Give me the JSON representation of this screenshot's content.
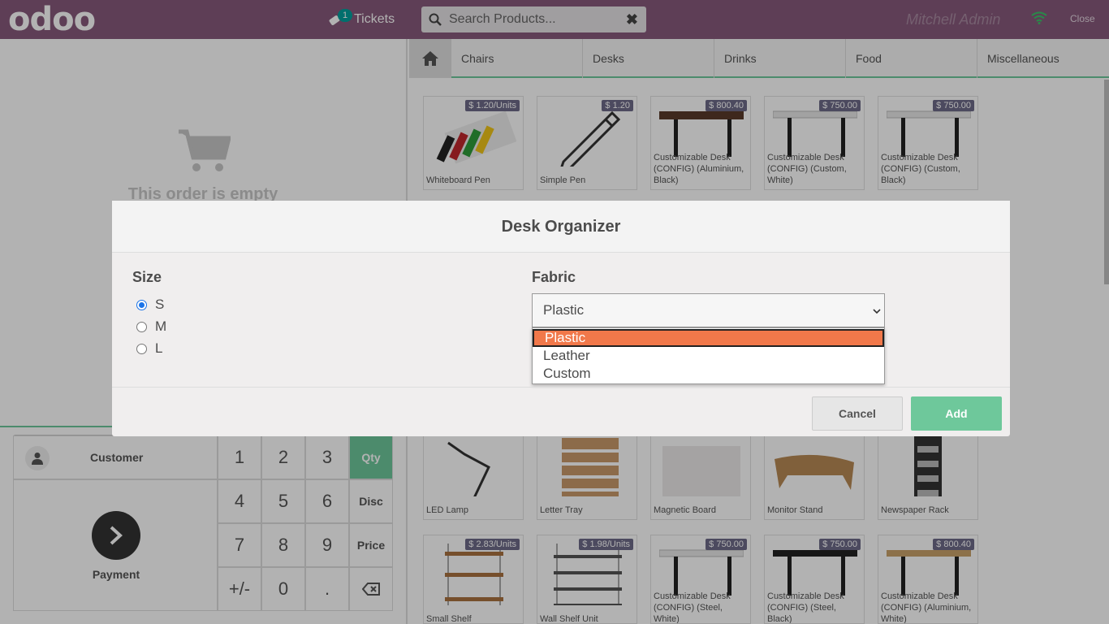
{
  "header": {
    "logo": "odoo",
    "tickets_label": "Tickets",
    "tickets_count": "1",
    "search_placeholder": "Search Products...",
    "user_name": "Mitchell Admin",
    "close_label": "Close"
  },
  "order": {
    "empty_text": "This order is empty"
  },
  "pad": {
    "customer_label": "Customer",
    "payment_label": "Payment",
    "keys": [
      "1",
      "2",
      "3",
      "Qty",
      "4",
      "5",
      "6",
      "Disc",
      "7",
      "8",
      "9",
      "Price",
      "+/-",
      "0",
      ".",
      "⌫"
    ]
  },
  "categories": [
    "Chairs",
    "Desks",
    "Drinks",
    "Food",
    "Miscellaneous"
  ],
  "products_row1": [
    {
      "name": "Whiteboard Pen",
      "price": "$ 1.20/Units"
    },
    {
      "name": "Simple Pen",
      "price": "$ 1.20"
    },
    {
      "name": "Customizable Desk (CONFIG) (Aluminium, Black)",
      "price": "$ 800.40"
    },
    {
      "name": "Customizable Desk (CONFIG) (Custom, White)",
      "price": "$ 750.00"
    },
    {
      "name": "Customizable Desk (CONFIG) (Custom, Black)",
      "price": "$ 750.00"
    }
  ],
  "products_row2": [
    {
      "name": "LED Lamp"
    },
    {
      "name": "Letter Tray"
    },
    {
      "name": "Magnetic Board"
    },
    {
      "name": "Monitor Stand"
    },
    {
      "name": "Newspaper Rack"
    }
  ],
  "products_row3": [
    {
      "name": "Small Shelf",
      "price": "$ 2.83/Units"
    },
    {
      "name": "Wall Shelf Unit",
      "price": "$ 1.98/Units"
    },
    {
      "name": "Customizable Desk (CONFIG) (Steel, White)",
      "price": "$ 750.00"
    },
    {
      "name": "Customizable Desk (CONFIG) (Steel, Black)",
      "price": "$ 750.00"
    },
    {
      "name": "Customizable Desk (CONFIG) (Aluminium, White)",
      "price": "$ 800.40"
    }
  ],
  "modal": {
    "title": "Desk Organizer",
    "size_label": "Size",
    "size_options": [
      "S",
      "M",
      "L"
    ],
    "size_selected": "S",
    "fabric_label": "Fabric",
    "fabric_selected": "Plastic",
    "fabric_options": [
      "Plastic",
      "Leather",
      "Custom"
    ],
    "cancel_label": "Cancel",
    "add_label": "Add"
  },
  "colors": {
    "header_bg": "#875a7b",
    "accent_green": "#6ec89b",
    "highlight_orange": "#f1784a",
    "price_tag": "#6e6b89"
  }
}
